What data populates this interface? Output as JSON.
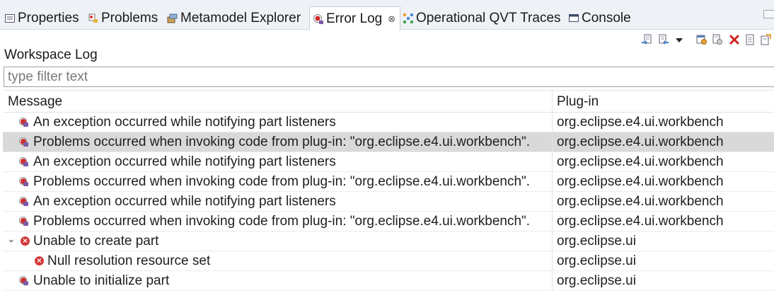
{
  "tabs": [
    {
      "label": "Properties",
      "icon": "properties-icon",
      "active": false
    },
    {
      "label": "Problems",
      "icon": "problems-icon",
      "active": false
    },
    {
      "label": "Metamodel Explorer",
      "icon": "metamodel-icon",
      "active": false
    },
    {
      "label": "Error Log",
      "icon": "error-log-icon",
      "active": true,
      "close": "⊗"
    },
    {
      "label": "Operational QVT Traces",
      "icon": "qvt-traces-icon",
      "active": false
    },
    {
      "label": "Console",
      "icon": "console-icon",
      "active": false
    }
  ],
  "toolbar": {
    "icons": [
      "export-log-icon",
      "import-log-icon",
      "view-menu-icon",
      "filter-icon",
      "clear-log-icon",
      "delete-log-icon",
      "open-log-icon",
      "restore-log-icon"
    ]
  },
  "log": {
    "title": "Workspace Log",
    "filter_placeholder": "type filter text"
  },
  "table": {
    "columns": [
      "Message",
      "Plug-in"
    ],
    "rows": [
      {
        "message": "An exception occurred while notifying part listeners",
        "plugin": "org.eclipse.e4.ui.workbench",
        "icon": "plugin-error-icon",
        "level": 0,
        "selected": false
      },
      {
        "message": "Problems occurred when invoking code from plug-in: \"org.eclipse.e4.ui.workbench\".",
        "plugin": "org.eclipse.e4.ui.workbench",
        "icon": "plugin-error-icon",
        "level": 0,
        "selected": true
      },
      {
        "message": "An exception occurred while notifying part listeners",
        "plugin": "org.eclipse.e4.ui.workbench",
        "icon": "plugin-error-icon",
        "level": 0,
        "selected": false
      },
      {
        "message": "Problems occurred when invoking code from plug-in: \"org.eclipse.e4.ui.workbench\".",
        "plugin": "org.eclipse.e4.ui.workbench",
        "icon": "plugin-error-icon",
        "level": 0,
        "selected": false
      },
      {
        "message": "An exception occurred while notifying part listeners",
        "plugin": "org.eclipse.e4.ui.workbench",
        "icon": "plugin-error-icon",
        "level": 0,
        "selected": false
      },
      {
        "message": "Problems occurred when invoking code from plug-in: \"org.eclipse.e4.ui.workbench\".",
        "plugin": "org.eclipse.e4.ui.workbench",
        "icon": "plugin-error-icon",
        "level": 0,
        "selected": false
      },
      {
        "message": "Unable to create part",
        "plugin": "org.eclipse.ui",
        "icon": "error-icon",
        "level": 0,
        "expanded": true,
        "selected": false
      },
      {
        "message": "Null resolution resource set",
        "plugin": "org.eclipse.ui",
        "icon": "error-icon",
        "level": 1,
        "selected": false
      },
      {
        "message": "Unable to initialize part",
        "plugin": "org.eclipse.ui",
        "icon": "plugin-error-icon",
        "level": 0,
        "selected": false
      }
    ]
  },
  "colors": {
    "selected_row": "#d9d9d9",
    "error_red": "#d02e2e",
    "tab_bar": "#eef1f6"
  }
}
